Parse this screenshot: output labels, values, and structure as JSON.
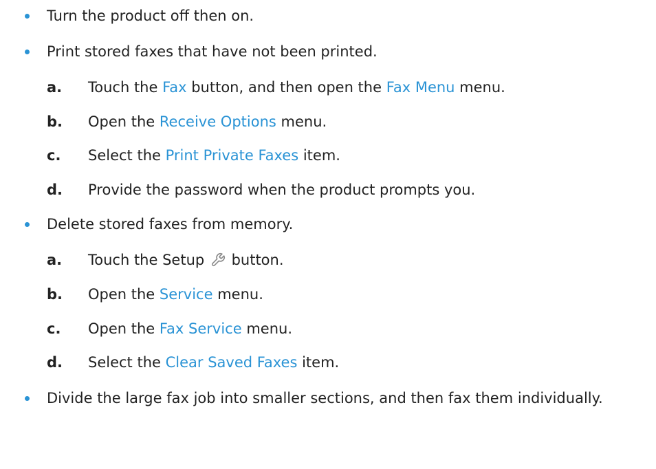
{
  "colors": {
    "bullet": "#2a93d5",
    "highlight": "#2a93d5",
    "text": "#222222"
  },
  "items": [
    {
      "text": "Turn the product off then on."
    },
    {
      "text": "Print stored faxes that have not been printed.",
      "steps": [
        {
          "letter": "a.",
          "parts": [
            "Touch the ",
            "Fax",
            " button, and then open the ",
            "Fax Menu",
            " menu."
          ]
        },
        {
          "letter": "b.",
          "parts": [
            "Open the ",
            "Receive Options",
            " menu."
          ]
        },
        {
          "letter": "c.",
          "parts": [
            "Select the ",
            "Print Private Faxes",
            " item."
          ]
        },
        {
          "letter": "d.",
          "parts": [
            "Provide the password when the product prompts you."
          ]
        }
      ]
    },
    {
      "text": "Delete stored faxes from memory.",
      "steps": [
        {
          "letter": "a.",
          "before": "Touch the Setup ",
          "icon": "wrench-icon",
          "after": " button."
        },
        {
          "letter": "b.",
          "parts": [
            "Open the ",
            "Service",
            " menu."
          ]
        },
        {
          "letter": "c.",
          "parts": [
            "Open the ",
            "Fax Service",
            " menu."
          ]
        },
        {
          "letter": "d.",
          "parts": [
            "Select the ",
            "Clear Saved Faxes",
            " item."
          ]
        }
      ]
    },
    {
      "text": "Divide the large fax job into smaller sections, and then fax them individually."
    }
  ]
}
